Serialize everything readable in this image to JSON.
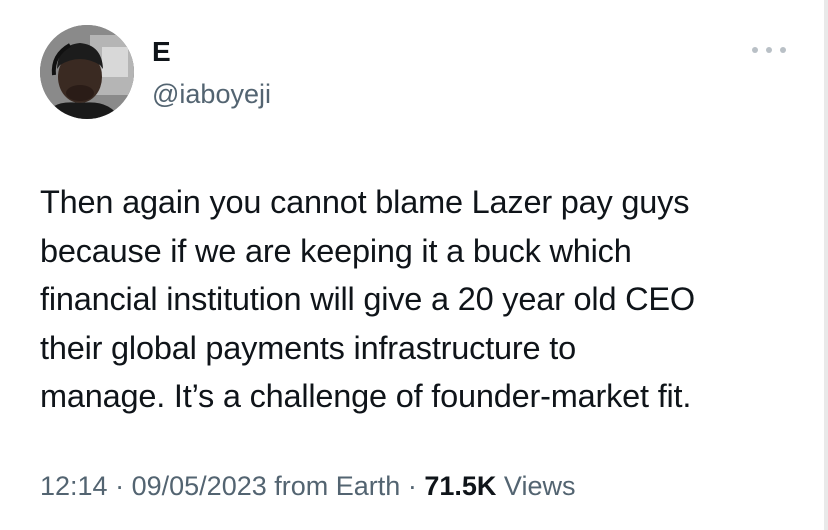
{
  "author": {
    "display_name": "E",
    "handle": "@iaboyeji",
    "avatar_icon": "profile-photo"
  },
  "more_icon": "more-options-icon",
  "tweet": {
    "text": "Then again you cannot blame Lazer pay guys\nbecause if we are keeping it a buck which\nfinancial institution will give a 20 year old CEO\ntheir global payments infrastructure to\nmanage. It’s a challenge of founder-market fit."
  },
  "meta": {
    "time": "12:14",
    "separator": "·",
    "date": "09/05/2023",
    "source": "from Earth",
    "views_count": "71.5K",
    "views_label": "Views"
  },
  "colors": {
    "text": "#0f1419",
    "secondary": "#536471",
    "background": "#ffffff"
  }
}
